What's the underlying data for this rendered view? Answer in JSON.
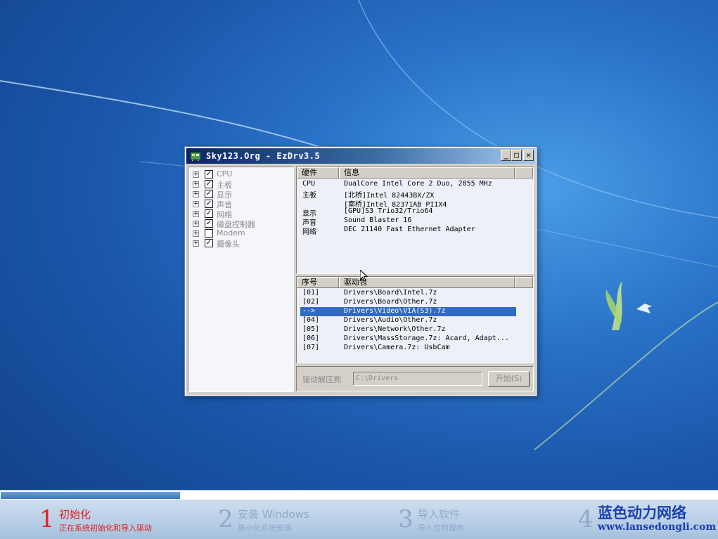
{
  "window": {
    "title": "Sky123.Org - EzDrv3.5",
    "buttons": {
      "minimize": "_",
      "maximize": "□",
      "close": "✕"
    }
  },
  "tree": [
    {
      "label": "CPU",
      "checked": true,
      "dim": true
    },
    {
      "label": "主板",
      "checked": true,
      "dim": true
    },
    {
      "label": "显示",
      "checked": true,
      "dim": true
    },
    {
      "label": "声音",
      "checked": true,
      "dim": true
    },
    {
      "label": "网络",
      "checked": true,
      "dim": true
    },
    {
      "label": "磁盘控制器",
      "checked": true,
      "dim": true
    },
    {
      "label": "Modem",
      "checked": false,
      "dim": true
    },
    {
      "label": "摄像头",
      "checked": true,
      "dim": true
    }
  ],
  "hardware": {
    "headers": [
      "硬件",
      "信息"
    ],
    "rows": [
      [
        "CPU",
        "DualCore Intel Core 2 Duo, 2855 MHz"
      ],
      [
        "主板",
        "[北桥]Intel 82443BX/ZX"
      ],
      [
        "",
        "[南桥]Intel 82371AB PIIX4"
      ],
      [
        "显示",
        "[GPU]S3 Trio32/Trio64"
      ],
      [
        "声音",
        "Sound Blaster 16"
      ],
      [
        "网络",
        "DEC 21140 Fast Ethernet Adapter"
      ]
    ]
  },
  "drivers": {
    "headers": [
      "序号",
      "驱动包"
    ],
    "rows": [
      [
        "[01]",
        "Drivers\\Board\\Intel.7z"
      ],
      [
        "[02]",
        "Drivers\\Board\\Other.7z"
      ],
      [
        "-->",
        "Drivers\\Video\\VIA(S3).7z"
      ],
      [
        "[04]",
        "Drivers\\Audio\\Other.7z"
      ],
      [
        "[05]",
        "Drivers\\Network\\Other.7z"
      ],
      [
        "[06]",
        "Drivers\\MassStorage.7z: Acard, Adapt..."
      ],
      [
        "[07]",
        "Drivers\\Camera.7z: UsbCam"
      ]
    ],
    "selected_index": 2
  },
  "extract": {
    "label": "驱动解压到",
    "path": "C:\\Drivers",
    "start_button": "开始(S)"
  },
  "setup": {
    "progress": 0.25,
    "steps": [
      {
        "num": "1",
        "title": "初始化",
        "subtitle": "正在系统初始化和导入驱动",
        "active": true
      },
      {
        "num": "2",
        "title": "安装 Windows",
        "subtitle": "最小化系统安装",
        "active": false
      },
      {
        "num": "3",
        "title": "导入软件",
        "subtitle": "导入应用程序",
        "active": false
      },
      {
        "num": "4",
        "title": "",
        "subtitle": "",
        "active": false
      }
    ]
  },
  "brand": {
    "name": "蓝色动力网络",
    "url": "www.lansedongli.com"
  },
  "colors": {
    "selection": "#316ac5",
    "active_step": "#e0201f",
    "brand": "#1a3fb0"
  }
}
